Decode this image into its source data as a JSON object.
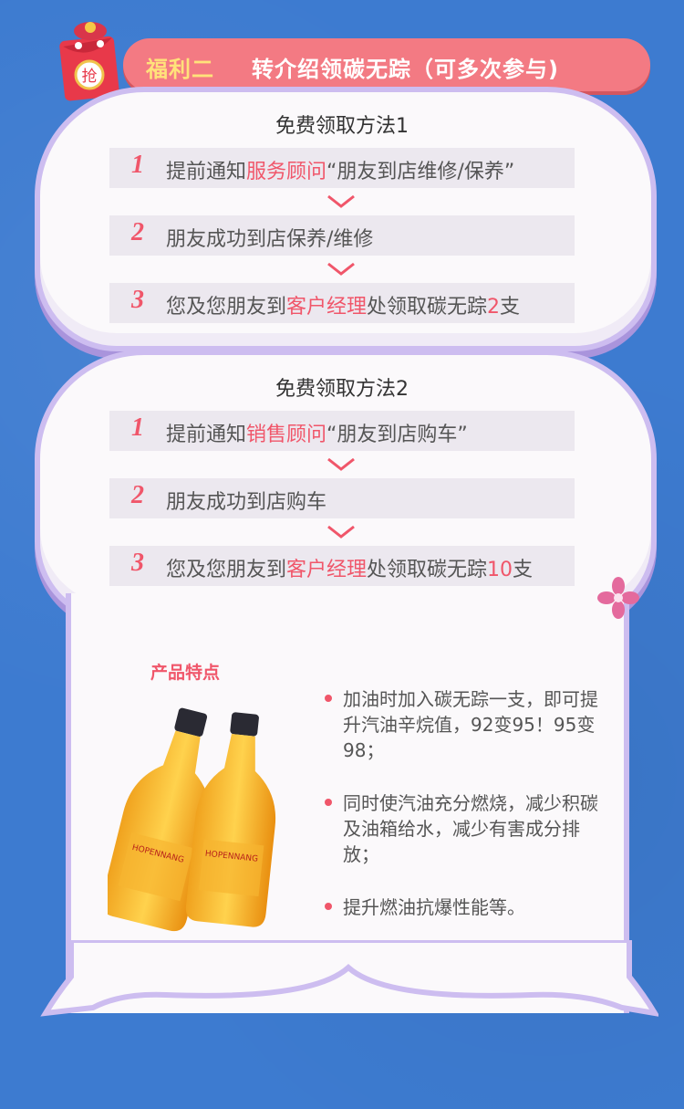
{
  "header": {
    "title": "福利二",
    "subtitle": "转介绍领碳无踪（可多次参与)"
  },
  "mascot": {
    "badge": "抢"
  },
  "method1": {
    "title": "免费领取方法1",
    "steps": [
      {
        "num": "1",
        "pre": "提前通知",
        "hl": "服务顾问",
        "post": "“朋友到店维修/保养”"
      },
      {
        "num": "2",
        "pre": "朋友成功到店保养/维修",
        "hl": "",
        "post": ""
      },
      {
        "num": "3",
        "pre": "您及您朋友到",
        "hl": "客户经理",
        "mid": "处领取碳无踪",
        "count": "2",
        "post": "支"
      }
    ]
  },
  "method2": {
    "title": "免费领取方法2",
    "steps": [
      {
        "num": "1",
        "pre": "提前通知",
        "hl": "销售顾问",
        "post": "“朋友到店购车”"
      },
      {
        "num": "2",
        "pre": "朋友成功到店购车",
        "hl": "",
        "post": ""
      },
      {
        "num": "3",
        "pre": "您及您朋友到",
        "hl": "客户经理",
        "mid": "处领取碳无踪",
        "count": "10",
        "post": "支"
      }
    ]
  },
  "product": {
    "title": "产品特点",
    "brand": "HOPENNANG",
    "features": [
      "加油时加入碳无踪一支，即可提升汽油辛烷值，92变95！95变98；",
      "同时使汽油充分燃烧，减少积碳及油箱给水，减少有害成分排放；",
      "提升燃油抗爆性能等。"
    ]
  },
  "colors": {
    "background": "#3d7bd0",
    "accent": "#f0566a",
    "banner": "#f37a83",
    "banner_title": "#ffe27a",
    "cloud_border": "#cdbdf0"
  }
}
